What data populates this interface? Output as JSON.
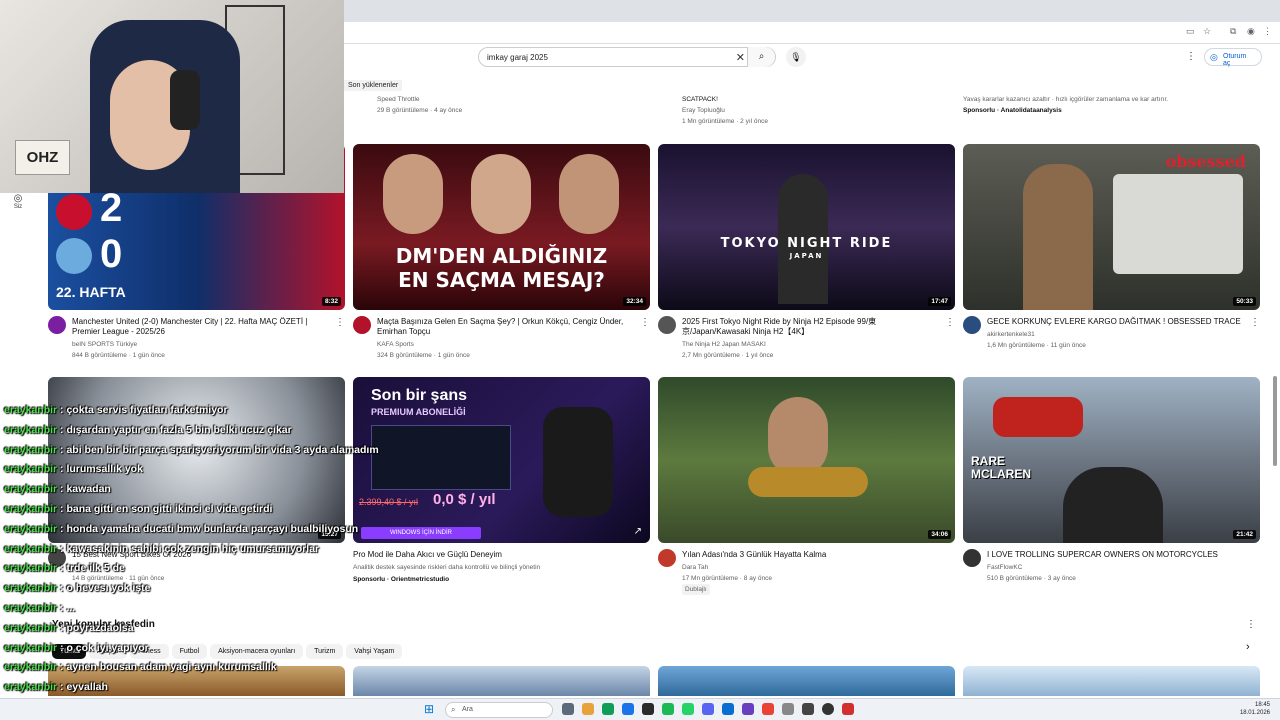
{
  "search": {
    "value": "imkay garaj 2025"
  },
  "header": {
    "signin_label": "Oturum aç"
  },
  "sidebar": {
    "you_label": "Siz"
  },
  "section_label": "Son yüklenenler",
  "prev_row": [
    {
      "line1": "Speed Throttle",
      "line2": "29 B görüntüleme · 4 ay önce"
    },
    {
      "line1": "SCATPACK!",
      "line2": "Eray Topluoğlu",
      "line3": "1 Mn görüntüleme · 2 yıl önce"
    },
    {
      "line1": "Yavaş kararlar kazanıcı azaltır · hızlı içgörüler zamanlama ve kar artırır.",
      "line2": "Sponsorlu · Anatolidataanalysis"
    }
  ],
  "videos_row1": [
    {
      "duration": "8:32",
      "thumb_text": "22. HAFTA",
      "score_a": "2",
      "score_b": "0",
      "title": "Manchester United (2-0) Manchester City | 22. Hafta MAÇ ÖZETİ | Premier League - 2025/26",
      "channel": "beIN SPORTS Türkiye",
      "meta": "844 B görüntüleme · 1 gün önce",
      "avatar_color": "#7a1fa2"
    },
    {
      "duration": "32:34",
      "thumb_text": "DM'DEN ALDIĞINIZ EN SAÇMA MESAJ?",
      "title": "Maçta Başınıza Gelen En Saçma Şey? | Orkun Kökçü, Cengiz Ünder, Emirhan Topçu",
      "channel": "KAFA Sports",
      "meta": "324 B görüntüleme · 1 gün önce",
      "avatar_color": "#b3122b"
    },
    {
      "duration": "17:47",
      "thumb_text": "TOKYO NIGHT RIDE",
      "thumb_sub": "JAPAN",
      "title": "2025 First Tokyo Night Ride by Ninja H2 Episode 99/東京/Japan/Kawasaki Ninja H2【4K】",
      "channel": "The Ninja H2 Japan MASAKI",
      "meta": "2,7 Mn görüntüleme · 1 yıl önce",
      "avatar_color": "#555555"
    },
    {
      "duration": "50:33",
      "thumb_text": "obsessed",
      "title": "GECE KORKUNÇ EVLERE KARGO DAĞITMAK ! OBSESSED TRACE",
      "channel": "akirkertenkele31",
      "meta": "1,6 Mn görüntüleme · 11 gün önce",
      "avatar_color": "#2b4c7e"
    }
  ],
  "videos_row2": [
    {
      "duration": "15:27",
      "title": "15 Best New Sport Bikes Of 2026",
      "channel": "Auto Moto",
      "meta": "14 B görüntüleme · 11 gün önce",
      "avatar_color": "#444444"
    },
    {
      "duration": "",
      "thumb_text": "Son bir şans",
      "thumb_sub": "PREMIUM ABONELİĞİ",
      "price_old": "2.399,40 $ / yıl",
      "price_new": "0,0 $ / yıl",
      "cta": "WINDOWS İÇİN İNDİR",
      "title": "Pro Mod ile Daha Akıcı ve Güçlü Deneyim",
      "desc": "Analitik destek sayesinde riskleri daha kontrollü ve bilinçli yönetin",
      "channel": "Sponsorlu · Orientmetricstudio",
      "meta": "",
      "avatar_color": ""
    },
    {
      "duration": "34:06",
      "title": "Yılan Adası'nda 3 Günlük Hayatta Kalma",
      "channel": "Dara Tah",
      "meta": "17 Mn görüntüleme · 8 ay önce",
      "badge": "Dublajlı",
      "avatar_color": "#c0392b"
    },
    {
      "duration": "21:42",
      "thumb_text": "RARE MCLAREN",
      "title": "I LOVE TROLLING SUPERCAR OWNERS ON MOTORCYCLES",
      "channel": "FastFlowKC",
      "meta": "510 B görüntüleme · 3 ay önce",
      "avatar_color": "#333333"
    }
  ],
  "chat": [
    {
      "user": "eraykanbir",
      "msg": "çokta servis fiyatları farketmiyor"
    },
    {
      "user": "eraykanbir",
      "msg": "dışardan yaptır en fazla 5 bin belki ucuz çıkar"
    },
    {
      "user": "eraykanbir",
      "msg": "abi ben bir bir parça sparişveriyorum bir vida 3 ayda alamadım"
    },
    {
      "user": "eraykanbir",
      "msg": "lurumsallık yok"
    },
    {
      "user": "eraykanbir",
      "msg": "kawadan"
    },
    {
      "user": "eraykanbir",
      "msg": "bana gitti en son gitti ikinci el vida getirdi"
    },
    {
      "user": "eraykanbir",
      "msg": "honda yamaha ducati bmw bunlarda parçayı bualbiliyosun"
    },
    {
      "user": "eraykanbir",
      "msg": "kawasakinin sahibi çok zengin hiç umursamıyorlar"
    },
    {
      "user": "eraykanbir",
      "msg": "trde ilk 5 de"
    },
    {
      "user": "eraykanbir",
      "msg": "o hevesı yok işte"
    },
    {
      "user": "eraykanbir",
      "msg": "..."
    },
    {
      "user": "eraykanbir",
      "msg": "poyrazdaolsa"
    },
    {
      "user": "eraykanbir",
      "msg": "o çok iyi yapıyor"
    },
    {
      "user": "eraykanbir",
      "msg": "aynen bousan adam yagi aynı kurumsallık"
    },
    {
      "user": "eraykanbir",
      "msg": "eyvallah"
    }
  ],
  "explore": {
    "title": "Yeni konular keşfedin",
    "chips": [
      "Tümü",
      "Araçlar",
      "Fitness",
      "Futbol",
      "Aksiyon-macera oyunları",
      "Turizm",
      "Vahşi Yaşam"
    ]
  },
  "taskbar": {
    "search_placeholder": "Ara",
    "time": "18:45",
    "date": "18.01.2026"
  },
  "colors": {
    "accent": "#065fd4",
    "chat_user": "#4ee04e"
  }
}
